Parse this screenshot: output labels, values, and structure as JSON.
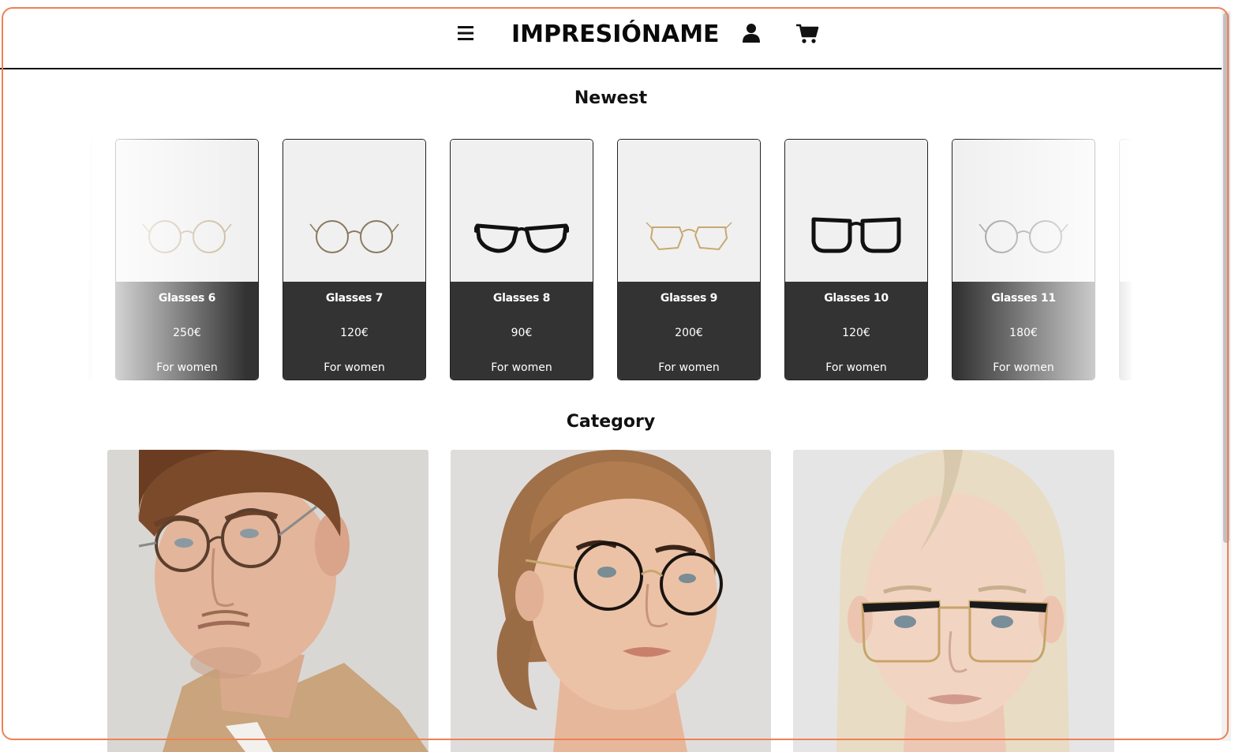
{
  "header": {
    "brand": "IMPRESIÓNAME",
    "menu_icon": "hamburger-menu-icon",
    "user_icon": "user-icon",
    "cart_icon": "shopping-cart-icon"
  },
  "newest": {
    "title": "Newest",
    "products": [
      {
        "name": "Glasses 6",
        "price": "250€",
        "tag": "For women",
        "frame_color": "#c9b89a",
        "style": "round-thin"
      },
      {
        "name": "Glasses 7",
        "price": "120€",
        "tag": "For women",
        "frame_color": "#8a7a60",
        "style": "round-thin"
      },
      {
        "name": "Glasses 8",
        "price": "90€",
        "tag": "For women",
        "frame_color": "#111111",
        "style": "cat-eye-thick"
      },
      {
        "name": "Glasses 9",
        "price": "200€",
        "tag": "For women",
        "frame_color": "#c8a870",
        "style": "octagon-thin"
      },
      {
        "name": "Glasses 10",
        "price": "120€",
        "tag": "For women",
        "frame_color": "#111111",
        "style": "square-thick"
      },
      {
        "name": "Glasses 11",
        "price": "180€",
        "tag": "For women",
        "frame_color": "#9a9a9a",
        "style": "round-thin"
      }
    ]
  },
  "category": {
    "title": "Category",
    "tiles": [
      {
        "name": "man-with-round-glasses",
        "bg": "#d8d6d2"
      },
      {
        "name": "woman-with-round-black-glasses",
        "bg": "#dedcda"
      },
      {
        "name": "blonde-woman-with-square-glasses",
        "bg": "#e4e4e4"
      }
    ]
  },
  "colors": {
    "accent_frame": "#f08055",
    "card_info_bg": "#333333",
    "card_img_bg": "#f0f0f0"
  }
}
